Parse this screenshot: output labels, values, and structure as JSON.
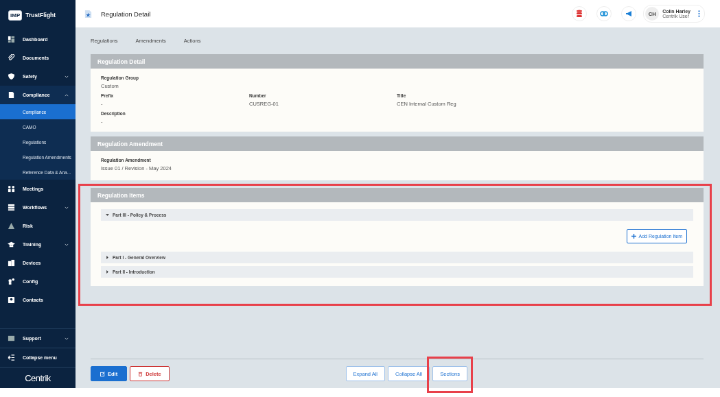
{
  "brand": {
    "badge": "IMP",
    "name": "TrustFlight"
  },
  "sidebar": {
    "items": [
      {
        "label": "Dashboard",
        "has_caret": false,
        "expanded": false,
        "selected": false
      },
      {
        "label": "Documents",
        "has_caret": false,
        "expanded": false,
        "selected": false
      },
      {
        "label": "Safety",
        "has_caret": true,
        "expanded": false,
        "selected": false
      },
      {
        "label": "Compliance",
        "has_caret": true,
        "expanded": true,
        "selected": false,
        "children": [
          {
            "label": "Compliance",
            "selected": true
          },
          {
            "label": "CAMO",
            "selected": false
          },
          {
            "label": "Regulations",
            "selected": false
          },
          {
            "label": "Regulation Amendments",
            "selected": false
          },
          {
            "label": "Reference Data & Ana...",
            "selected": false
          }
        ]
      },
      {
        "label": "Meetings",
        "has_caret": false,
        "expanded": false,
        "selected": false
      },
      {
        "label": "Workflows",
        "has_caret": true,
        "expanded": false,
        "selected": false
      },
      {
        "label": "Risk",
        "has_caret": false,
        "expanded": false,
        "selected": false
      },
      {
        "label": "Training",
        "has_caret": true,
        "expanded": false,
        "selected": false
      },
      {
        "label": "Devices",
        "has_caret": false,
        "expanded": false,
        "selected": false
      },
      {
        "label": "Config",
        "has_caret": false,
        "expanded": false,
        "selected": false
      },
      {
        "label": "Contacts",
        "has_caret": false,
        "expanded": false,
        "selected": false
      }
    ],
    "bottom": [
      {
        "label": "Support",
        "has_caret": true
      },
      {
        "label": "Collapse menu",
        "has_caret": false
      }
    ],
    "logo": "Centrik"
  },
  "header": {
    "title": "Regulation Detail",
    "user": {
      "initials": "CH",
      "name": "Colin Harley",
      "role": "Centrik User"
    }
  },
  "tabs": [
    {
      "label": "Regulations",
      "selected": false
    },
    {
      "label": "Amendments",
      "selected": false
    },
    {
      "label": "Actions",
      "selected": false
    }
  ],
  "detail": {
    "title": "Regulation Detail",
    "group": {
      "label": "Regulation Group",
      "value": "Custom"
    },
    "fields": [
      {
        "label": "Prefix",
        "value": "-"
      },
      {
        "label": "Number",
        "value": "CUSREG-01"
      },
      {
        "label": "Title",
        "value": "CEN Internal Custom Reg"
      }
    ],
    "description": {
      "label": "Description",
      "value": "-"
    }
  },
  "amendment": {
    "title": "Regulation Amendment",
    "label": "Regulation Amendment",
    "value": "Issue 01 / Revision - May 2024"
  },
  "items": {
    "title": "Regulation Items",
    "highlighted": true,
    "add_button": "Add Regulation Item",
    "parts": [
      {
        "label": "Part III - Policy & Process",
        "expanded": true
      },
      {
        "label": "Part I - General Overview",
        "expanded": false
      },
      {
        "label": "Part II - Introduction",
        "expanded": false
      }
    ]
  },
  "footer": {
    "left": [
      {
        "label": "Edit",
        "kind": "primary"
      },
      {
        "label": "Delete",
        "kind": "danger"
      }
    ],
    "right": [
      {
        "label": "Expand All",
        "highlighted": false
      },
      {
        "label": "Collapse All",
        "highlighted": false
      },
      {
        "label": "Sections",
        "highlighted": true
      }
    ]
  }
}
